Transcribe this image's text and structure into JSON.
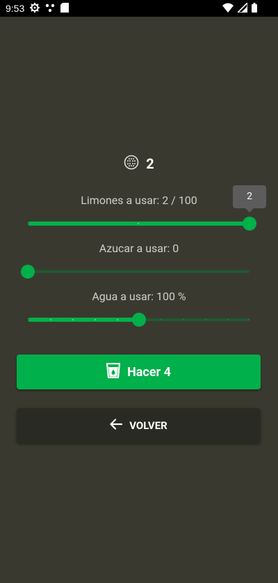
{
  "status_bar": {
    "time": "9:53",
    "left_icons": [
      "settings-icon",
      "dots-icon",
      "sim-card-icon"
    ],
    "right_icons": [
      "wifi-icon",
      "signal-icon",
      "battery-icon"
    ]
  },
  "counter": {
    "icon": "sphere-grid-icon",
    "value": "2"
  },
  "sliders": [
    {
      "label": "Limones a usar: 2 / 100",
      "value_fraction": 1.0,
      "tooltip": "2"
    },
    {
      "label": "Azucar a usar: 0",
      "value_fraction": 0.0
    },
    {
      "label": "Agua a usar: 100 %",
      "value_fraction": 0.5
    }
  ],
  "buttons": {
    "make_label": "Hacer 4",
    "make_icon": "cup-icon",
    "back_label": "VOLVER",
    "back_icon": "arrow-left-icon"
  },
  "colors": {
    "background": "#3a3930",
    "accent": "#00b04a",
    "track_inactive": "#1f5a31",
    "secondary_button": "#2a2a24",
    "tooltip": "#5c5c5c"
  }
}
